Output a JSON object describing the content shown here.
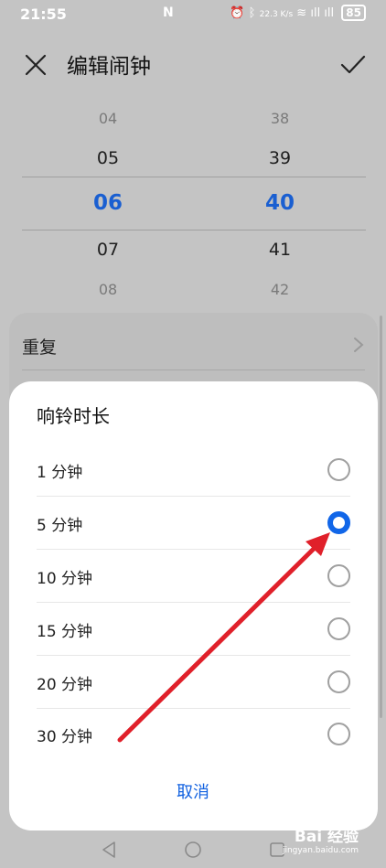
{
  "status": {
    "time": "21:55",
    "nfc": "N",
    "net_speed": "22.3 K/s",
    "battery": "85",
    "signal": "ıll ıll"
  },
  "header": {
    "title": "编辑闹钟",
    "close_icon": "close-icon",
    "confirm_icon": "check-icon"
  },
  "picker": {
    "hours": [
      "04",
      "05",
      "06",
      "07",
      "08"
    ],
    "minutes": [
      "38",
      "39",
      "40",
      "41",
      "42"
    ],
    "selected_color": "#1a5fd1"
  },
  "settings": {
    "repeat_label": "重复"
  },
  "dialog": {
    "title": "响铃时长",
    "options": [
      {
        "label": "1 分钟",
        "selected": false
      },
      {
        "label": "5 分钟",
        "selected": true
      },
      {
        "label": "10 分钟",
        "selected": false
      },
      {
        "label": "15 分钟",
        "selected": false
      },
      {
        "label": "20 分钟",
        "selected": false
      },
      {
        "label": "30 分钟",
        "selected": false
      }
    ],
    "cancel_label": "取消",
    "accent_color": "#1166e8"
  },
  "annotation": {
    "arrow_color": "#e0202a"
  },
  "watermark": {
    "brand": "Bai 经验",
    "url": "jingyan.baidu.com"
  }
}
